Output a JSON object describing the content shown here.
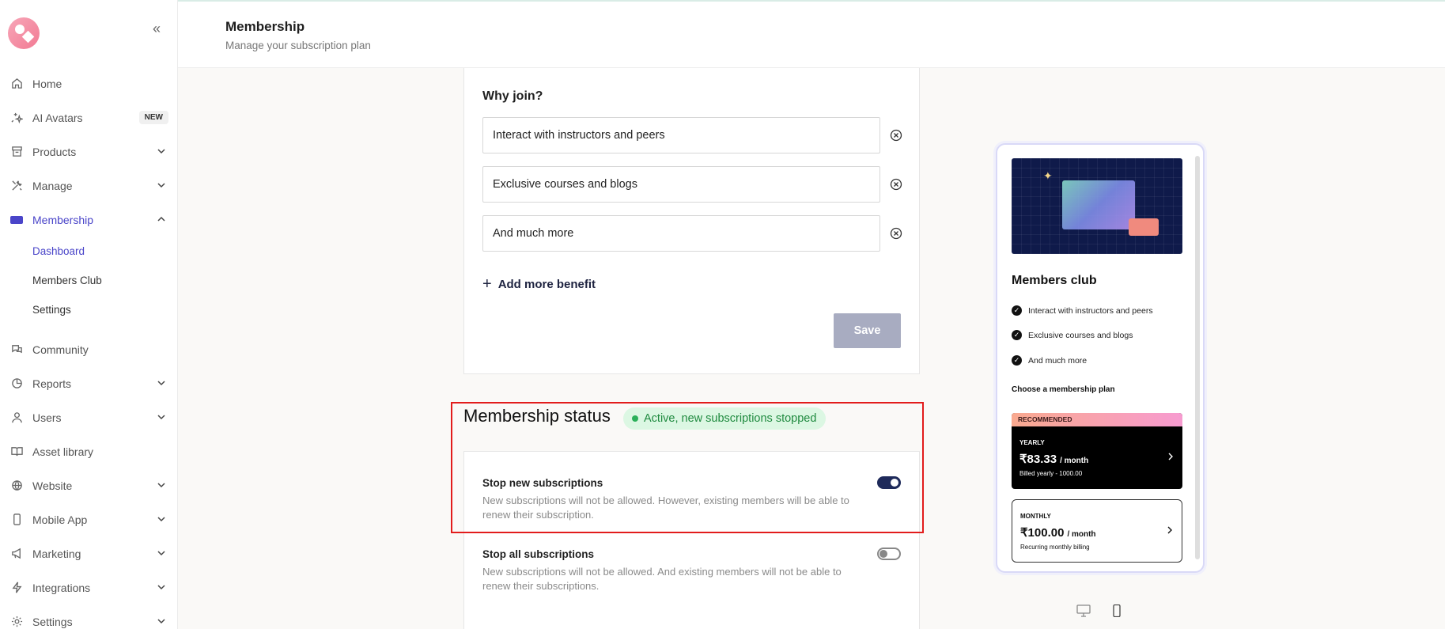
{
  "sidebar": {
    "collapse_icon": "double-chevron-left-icon",
    "items": [
      {
        "label": "Home",
        "icon": "home-icon"
      },
      {
        "label": "AI Avatars",
        "icon": "sparkle-icon",
        "badge": "NEW"
      },
      {
        "label": "Products",
        "icon": "box-icon"
      },
      {
        "label": "Manage",
        "icon": "tools-icon"
      },
      {
        "label": "Membership",
        "icon": "ticket-icon"
      },
      {
        "label": "Community",
        "icon": "chat-icon"
      },
      {
        "label": "Reports",
        "icon": "pie-chart-icon"
      },
      {
        "label": "Users",
        "icon": "user-icon"
      },
      {
        "label": "Asset library",
        "icon": "book-icon"
      },
      {
        "label": "Website",
        "icon": "globe-icon"
      },
      {
        "label": "Mobile App",
        "icon": "phone-icon"
      },
      {
        "label": "Marketing",
        "icon": "megaphone-icon"
      },
      {
        "label": "Integrations",
        "icon": "bolt-icon"
      },
      {
        "label": "Settings",
        "icon": "gear-icon"
      }
    ],
    "membership_sub": [
      "Dashboard",
      "Members Club",
      "Settings"
    ]
  },
  "header": {
    "title": "Membership",
    "subtitle": "Manage your subscription plan"
  },
  "benefits": {
    "heading": "Why join?",
    "items": [
      "Interact with instructors and peers",
      "Exclusive courses and blogs",
      "And much more"
    ],
    "add_label": "Add more benefit",
    "save_label": "Save"
  },
  "status": {
    "title": "Membership status",
    "pill": "Active, new subscriptions stopped",
    "options": [
      {
        "title": "Stop new subscriptions",
        "desc": "New subscriptions will not be allowed. However, existing members will be able to renew their subscription.",
        "enabled": true
      },
      {
        "title": "Stop all subscriptions",
        "desc": "New subscriptions will not be allowed. And existing members will not be able to renew their subscriptions.",
        "enabled": false
      }
    ]
  },
  "preview": {
    "title": "Members club",
    "items": [
      "Interact with instructors and peers",
      "Exclusive courses and blogs",
      "And much more"
    ],
    "choose_label": "Choose a membership plan",
    "yearly": {
      "badge": "RECOMMENDED",
      "label": "YEARLY",
      "price": "₹83.33",
      "per": "/ month",
      "note": "Billed yearly - 1000.00"
    },
    "monthly": {
      "label": "MONTHLY",
      "price": "₹100.00",
      "per": "/ month",
      "note": "Recurring monthly billing"
    }
  },
  "colors": {
    "accent": "#4a45c9",
    "toggle_on": "#1e2a5a",
    "highlight": "#e21c1c",
    "status_green": "#1f8a3f"
  }
}
